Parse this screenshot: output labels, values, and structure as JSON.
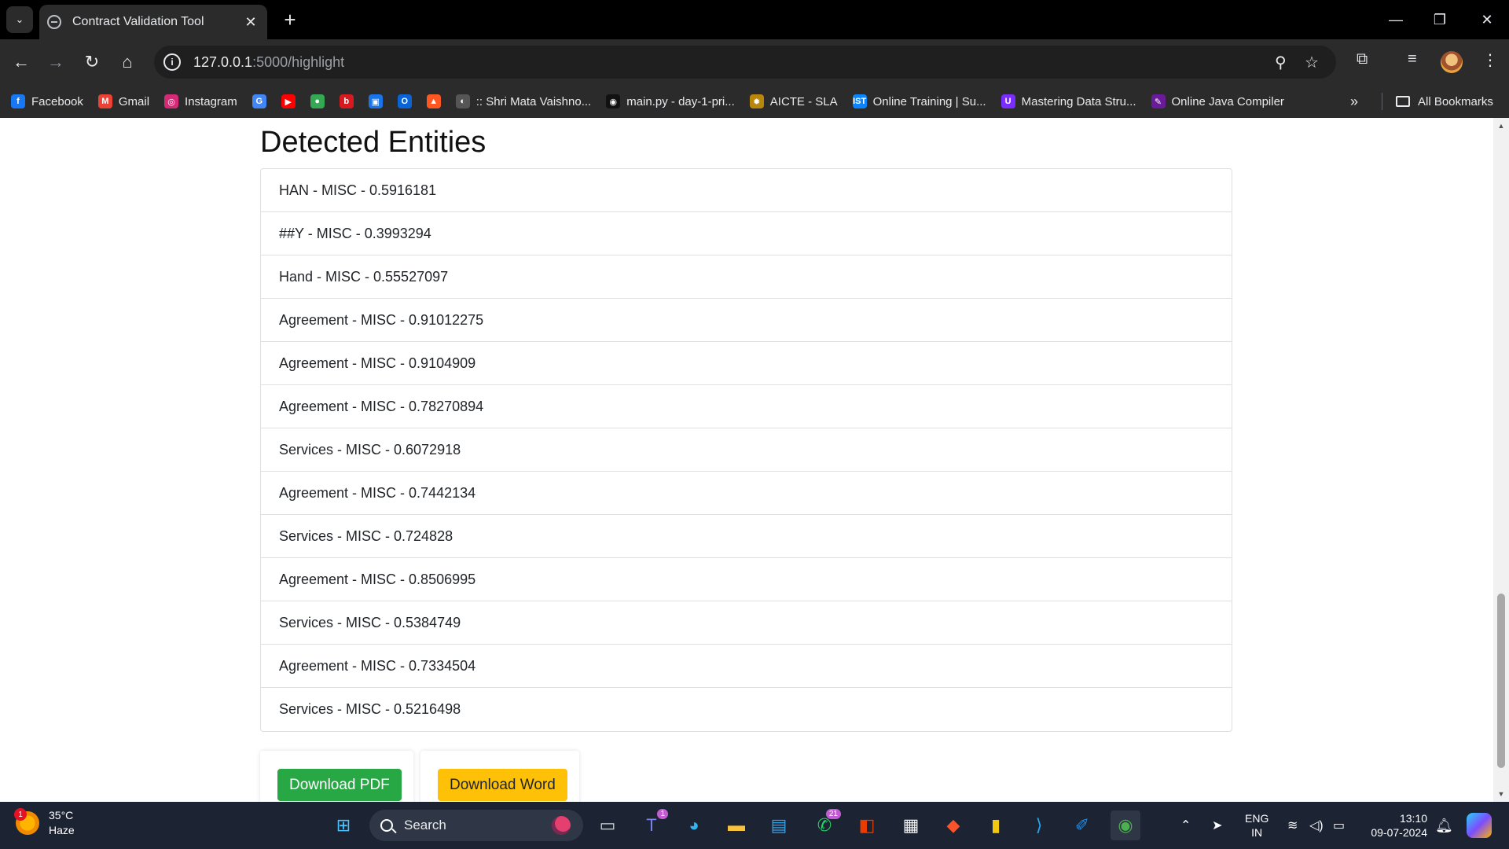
{
  "browser": {
    "tab_title": "Contract Validation Tool",
    "url_host": "127.0.0.1",
    "url_path": ":5000/highlight",
    "bookmarks": [
      {
        "label": "Facebook",
        "icon": "facebook-icon",
        "color": "#1877f2",
        "glyph": "f"
      },
      {
        "label": "Gmail",
        "icon": "gmail-icon",
        "color": "#ea4335",
        "glyph": "M"
      },
      {
        "label": "Instagram",
        "icon": "instagram-icon",
        "color": "#d62976",
        "glyph": "◎"
      },
      {
        "label": "",
        "icon": "google-icon",
        "color": "#4285f4",
        "glyph": "G"
      },
      {
        "label": "",
        "icon": "youtube-icon",
        "color": "#ff0000",
        "glyph": "▶"
      },
      {
        "label": "",
        "icon": "maps-icon",
        "color": "#34a853",
        "glyph": "●"
      },
      {
        "label": "",
        "icon": "bank-icon",
        "color": "#d71920",
        "glyph": "b"
      },
      {
        "label": "",
        "icon": "app-icon",
        "color": "#1a73e8",
        "glyph": "▣"
      },
      {
        "label": "",
        "icon": "outlook-icon",
        "color": "#0a64d6",
        "glyph": "O"
      },
      {
        "label": "",
        "icon": "fire-icon",
        "color": "#ff5722",
        "glyph": "▲"
      },
      {
        "label": ":: Shri Mata Vaishno...",
        "icon": "globe-icon",
        "color": "#555555",
        "glyph": "◐"
      },
      {
        "label": "main.py - day-1-pri...",
        "icon": "replit-icon",
        "color": "#111111",
        "glyph": "◉"
      },
      {
        "label": "AICTE - SLA",
        "icon": "aicte-icon",
        "color": "#b8860b",
        "glyph": "✹"
      },
      {
        "label": "Online Training | Su...",
        "icon": "ist-icon",
        "color": "#0a84ff",
        "glyph": "IST"
      },
      {
        "label": "Mastering Data Stru...",
        "icon": "course-icon",
        "color": "#7b2cff",
        "glyph": "U"
      },
      {
        "label": "Online Java Compiler",
        "icon": "compiler-icon",
        "color": "#6a1b9a",
        "glyph": "✎"
      }
    ],
    "all_bookmarks_label": "All Bookmarks"
  },
  "page": {
    "section_title": "Detected Entities",
    "entities": [
      "HAN - MISC - 0.5916181",
      "##Y - MISC - 0.3993294",
      "Hand - MISC - 0.55527097",
      "Agreement - MISC - 0.91012275",
      "Agreement - MISC - 0.9104909",
      "Agreement - MISC - 0.78270894",
      "Services - MISC - 0.6072918",
      "Agreement - MISC - 0.7442134",
      "Services - MISC - 0.724828",
      "Agreement - MISC - 0.8506995",
      "Services - MISC - 0.5384749",
      "Agreement - MISC - 0.7334504",
      "Services - MISC - 0.5216498"
    ],
    "download_pdf_label": "Download PDF",
    "download_word_label": "Download Word",
    "colors": {
      "pdf_button": "#28a745",
      "word_button": "#ffc107"
    }
  },
  "taskbar": {
    "weather_temp": "35°C",
    "weather_desc": "Haze",
    "weather_badge": "1",
    "search_label": "Search",
    "teams_badge": "1",
    "whatsapp_badge": "21",
    "lang_line1": "ENG",
    "lang_line2": "IN",
    "time": "13:10",
    "date": "09-07-2024"
  }
}
